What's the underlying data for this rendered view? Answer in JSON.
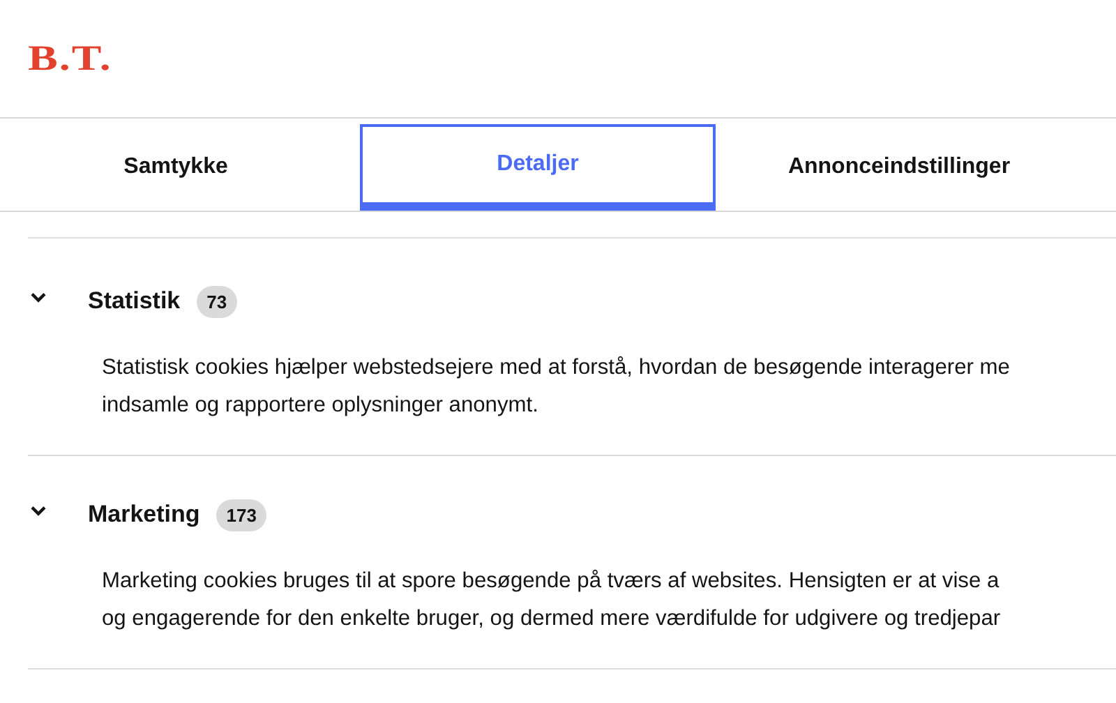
{
  "logo": "B.T.",
  "tabs": [
    {
      "label": "Samtykke",
      "selected": false
    },
    {
      "label": "Detaljer",
      "selected": true
    },
    {
      "label": "Annonceindstillinger",
      "selected": false
    }
  ],
  "sections": [
    {
      "title": "Statistik",
      "count": "73",
      "expanded": true,
      "description_lines": [
        "Statistisk cookies hjælper webstedsejere med at forstå, hvordan de besøgende interagerer me",
        "indsamle og rapportere oplysninger anonymt."
      ]
    },
    {
      "title": "Marketing",
      "count": "173",
      "expanded": true,
      "description_lines": [
        "Marketing cookies bruges til at spore besøgende på tværs af websites. Hensigten er at vise a",
        "og engagerende for den enkelte bruger, og dermed mere værdifulde for udgivere og tredjepar"
      ]
    }
  ]
}
